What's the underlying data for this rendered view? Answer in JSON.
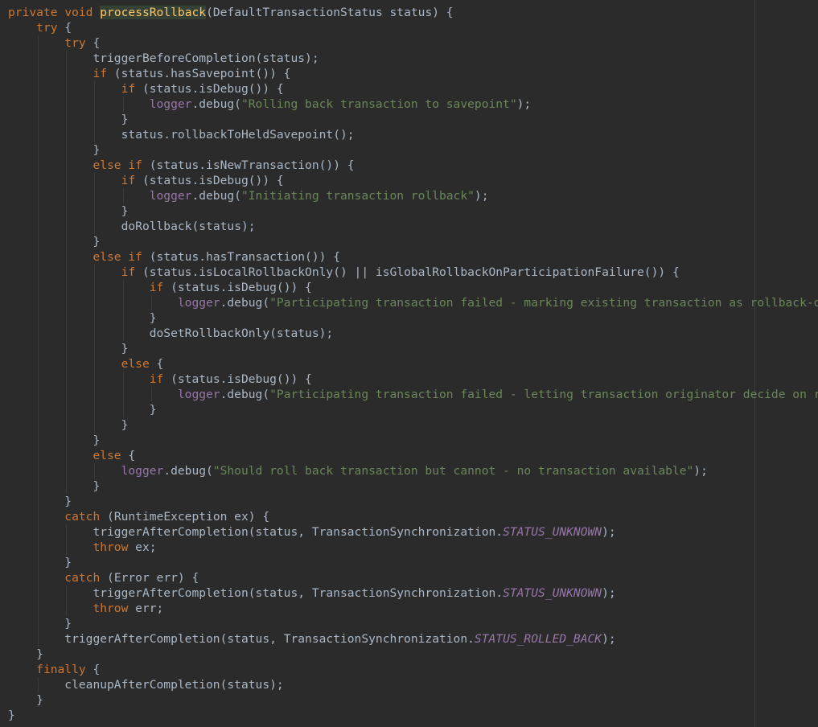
{
  "theme": {
    "background": "#2b2b2b",
    "default_text": "#a9b7c6",
    "keyword": "#cc7832",
    "method_declaration": "#ffc66d",
    "method_highlight_background": "#344134",
    "string": "#6a8759",
    "field": "#9876aa",
    "static_constant": "#9876aa"
  },
  "editor": {
    "lines": [
      [
        [
          "kw",
          "private"
        ],
        [
          "ws",
          " "
        ],
        [
          "kw",
          "void"
        ],
        [
          "ws",
          " "
        ],
        [
          "fn-hl",
          "processRollback"
        ],
        [
          "punct",
          "("
        ],
        [
          "plain",
          "DefaultTransactionStatus status"
        ],
        [
          "punct",
          ") {"
        ]
      ],
      [
        [
          "ws",
          "    "
        ],
        [
          "kw",
          "try"
        ],
        [
          "punct",
          " {"
        ]
      ],
      [
        [
          "ws",
          "        "
        ],
        [
          "kw",
          "try"
        ],
        [
          "punct",
          " {"
        ]
      ],
      [
        [
          "ws",
          "            "
        ],
        [
          "plain",
          "triggerBeforeCompletion"
        ],
        [
          "punct",
          "("
        ],
        [
          "plain",
          "status"
        ],
        [
          "punct",
          ");"
        ]
      ],
      [
        [
          "ws",
          "            "
        ],
        [
          "kw",
          "if"
        ],
        [
          "punct",
          " ("
        ],
        [
          "plain",
          "status.hasSavepoint"
        ],
        [
          "punct",
          "()) {"
        ]
      ],
      [
        [
          "ws",
          "                "
        ],
        [
          "kw",
          "if"
        ],
        [
          "punct",
          " ("
        ],
        [
          "plain",
          "status.isDebug"
        ],
        [
          "punct",
          "()) {"
        ]
      ],
      [
        [
          "ws",
          "                    "
        ],
        [
          "field",
          "logger"
        ],
        [
          "plain",
          ".debug"
        ],
        [
          "punct",
          "("
        ],
        [
          "str",
          "\"Rolling back transaction to savepoint\""
        ],
        [
          "punct",
          ");"
        ]
      ],
      [
        [
          "ws",
          "                "
        ],
        [
          "punct",
          "}"
        ]
      ],
      [
        [
          "ws",
          "                "
        ],
        [
          "plain",
          "status.rollbackToHeldSavepoint"
        ],
        [
          "punct",
          "();"
        ]
      ],
      [
        [
          "ws",
          "            "
        ],
        [
          "punct",
          "}"
        ]
      ],
      [
        [
          "ws",
          "            "
        ],
        [
          "kw",
          "else if"
        ],
        [
          "punct",
          " ("
        ],
        [
          "plain",
          "status.isNewTransaction"
        ],
        [
          "punct",
          "()) {"
        ]
      ],
      [
        [
          "ws",
          "                "
        ],
        [
          "kw",
          "if"
        ],
        [
          "punct",
          " ("
        ],
        [
          "plain",
          "status.isDebug"
        ],
        [
          "punct",
          "()) {"
        ]
      ],
      [
        [
          "ws",
          "                    "
        ],
        [
          "field",
          "logger"
        ],
        [
          "plain",
          ".debug"
        ],
        [
          "punct",
          "("
        ],
        [
          "str",
          "\"Initiating transaction rollback\""
        ],
        [
          "punct",
          ");"
        ]
      ],
      [
        [
          "ws",
          "                "
        ],
        [
          "punct",
          "}"
        ]
      ],
      [
        [
          "ws",
          "                "
        ],
        [
          "plain",
          "doRollback"
        ],
        [
          "punct",
          "("
        ],
        [
          "plain",
          "status"
        ],
        [
          "punct",
          ");"
        ]
      ],
      [
        [
          "ws",
          "            "
        ],
        [
          "punct",
          "}"
        ]
      ],
      [
        [
          "ws",
          "            "
        ],
        [
          "kw",
          "else if"
        ],
        [
          "punct",
          " ("
        ],
        [
          "plain",
          "status.hasTransaction"
        ],
        [
          "punct",
          "()) {"
        ]
      ],
      [
        [
          "ws",
          "                "
        ],
        [
          "kw",
          "if"
        ],
        [
          "punct",
          " ("
        ],
        [
          "plain",
          "status.isLocalRollbackOnly"
        ],
        [
          "punct",
          "() || "
        ],
        [
          "plain",
          "isGlobalRollbackOnParticipationFailure"
        ],
        [
          "punct",
          "()) {"
        ]
      ],
      [
        [
          "ws",
          "                    "
        ],
        [
          "kw",
          "if"
        ],
        [
          "punct",
          " ("
        ],
        [
          "plain",
          "status.isDebug"
        ],
        [
          "punct",
          "()) {"
        ]
      ],
      [
        [
          "ws",
          "                        "
        ],
        [
          "field",
          "logger"
        ],
        [
          "plain",
          ".debug"
        ],
        [
          "punct",
          "("
        ],
        [
          "str",
          "\"Participating transaction failed - marking existing transaction as rollback-only\""
        ],
        [
          "punct",
          ");"
        ]
      ],
      [
        [
          "ws",
          "                    "
        ],
        [
          "punct",
          "}"
        ]
      ],
      [
        [
          "ws",
          "                    "
        ],
        [
          "plain",
          "doSetRollbackOnly"
        ],
        [
          "punct",
          "("
        ],
        [
          "plain",
          "status"
        ],
        [
          "punct",
          ");"
        ]
      ],
      [
        [
          "ws",
          "                "
        ],
        [
          "punct",
          "}"
        ]
      ],
      [
        [
          "ws",
          "                "
        ],
        [
          "kw",
          "else"
        ],
        [
          "punct",
          " {"
        ]
      ],
      [
        [
          "ws",
          "                    "
        ],
        [
          "kw",
          "if"
        ],
        [
          "punct",
          " ("
        ],
        [
          "plain",
          "status.isDebug"
        ],
        [
          "punct",
          "()) {"
        ]
      ],
      [
        [
          "ws",
          "                        "
        ],
        [
          "field",
          "logger"
        ],
        [
          "plain",
          ".debug"
        ],
        [
          "punct",
          "("
        ],
        [
          "str",
          "\"Participating transaction failed - letting transaction originator decide on rollback\""
        ],
        [
          "punct",
          ");"
        ]
      ],
      [
        [
          "ws",
          "                    "
        ],
        [
          "punct",
          "}"
        ]
      ],
      [
        [
          "ws",
          "                "
        ],
        [
          "punct",
          "}"
        ]
      ],
      [
        [
          "ws",
          "            "
        ],
        [
          "punct",
          "}"
        ]
      ],
      [
        [
          "ws",
          "            "
        ],
        [
          "kw",
          "else"
        ],
        [
          "punct",
          " {"
        ]
      ],
      [
        [
          "ws",
          "                "
        ],
        [
          "field",
          "logger"
        ],
        [
          "plain",
          ".debug"
        ],
        [
          "punct",
          "("
        ],
        [
          "str",
          "\"Should roll back transaction but cannot - no transaction available\""
        ],
        [
          "punct",
          ");"
        ]
      ],
      [
        [
          "ws",
          "            "
        ],
        [
          "punct",
          "}"
        ]
      ],
      [
        [
          "ws",
          "        "
        ],
        [
          "punct",
          "}"
        ]
      ],
      [
        [
          "ws",
          "        "
        ],
        [
          "kw",
          "catch"
        ],
        [
          "punct",
          " ("
        ],
        [
          "plain",
          "RuntimeException ex"
        ],
        [
          "punct",
          ") {"
        ]
      ],
      [
        [
          "ws",
          "            "
        ],
        [
          "plain",
          "triggerAfterCompletion"
        ],
        [
          "punct",
          "("
        ],
        [
          "plain",
          "status"
        ],
        [
          "punct",
          ", "
        ],
        [
          "plain",
          "TransactionSynchronization."
        ],
        [
          "static",
          "STATUS_UNKNOWN"
        ],
        [
          "punct",
          ");"
        ]
      ],
      [
        [
          "ws",
          "            "
        ],
        [
          "kw",
          "throw"
        ],
        [
          "ws",
          " "
        ],
        [
          "plain",
          "ex"
        ],
        [
          "punct",
          ";"
        ]
      ],
      [
        [
          "ws",
          "        "
        ],
        [
          "punct",
          "}"
        ]
      ],
      [
        [
          "ws",
          "        "
        ],
        [
          "kw",
          "catch"
        ],
        [
          "punct",
          " ("
        ],
        [
          "plain",
          "Error err"
        ],
        [
          "punct",
          ") {"
        ]
      ],
      [
        [
          "ws",
          "            "
        ],
        [
          "plain",
          "triggerAfterCompletion"
        ],
        [
          "punct",
          "("
        ],
        [
          "plain",
          "status"
        ],
        [
          "punct",
          ", "
        ],
        [
          "plain",
          "TransactionSynchronization."
        ],
        [
          "static",
          "STATUS_UNKNOWN"
        ],
        [
          "punct",
          ");"
        ]
      ],
      [
        [
          "ws",
          "            "
        ],
        [
          "kw",
          "throw"
        ],
        [
          "ws",
          " "
        ],
        [
          "plain",
          "err"
        ],
        [
          "punct",
          ";"
        ]
      ],
      [
        [
          "ws",
          "        "
        ],
        [
          "punct",
          "}"
        ]
      ],
      [
        [
          "ws",
          "        "
        ],
        [
          "plain",
          "triggerAfterCompletion"
        ],
        [
          "punct",
          "("
        ],
        [
          "plain",
          "status"
        ],
        [
          "punct",
          ", "
        ],
        [
          "plain",
          "TransactionSynchronization."
        ],
        [
          "static",
          "STATUS_ROLLED_BACK"
        ],
        [
          "punct",
          ");"
        ]
      ],
      [
        [
          "ws",
          "    "
        ],
        [
          "punct",
          "}"
        ]
      ],
      [
        [
          "ws",
          "    "
        ],
        [
          "kw",
          "finally"
        ],
        [
          "punct",
          " {"
        ]
      ],
      [
        [
          "ws",
          "        "
        ],
        [
          "plain",
          "cleanupAfterCompletion"
        ],
        [
          "punct",
          "("
        ],
        [
          "plain",
          "status"
        ],
        [
          "punct",
          ");"
        ]
      ],
      [
        [
          "ws",
          "    "
        ],
        [
          "punct",
          "}"
        ]
      ],
      [
        [
          "punct",
          "}"
        ]
      ]
    ]
  }
}
